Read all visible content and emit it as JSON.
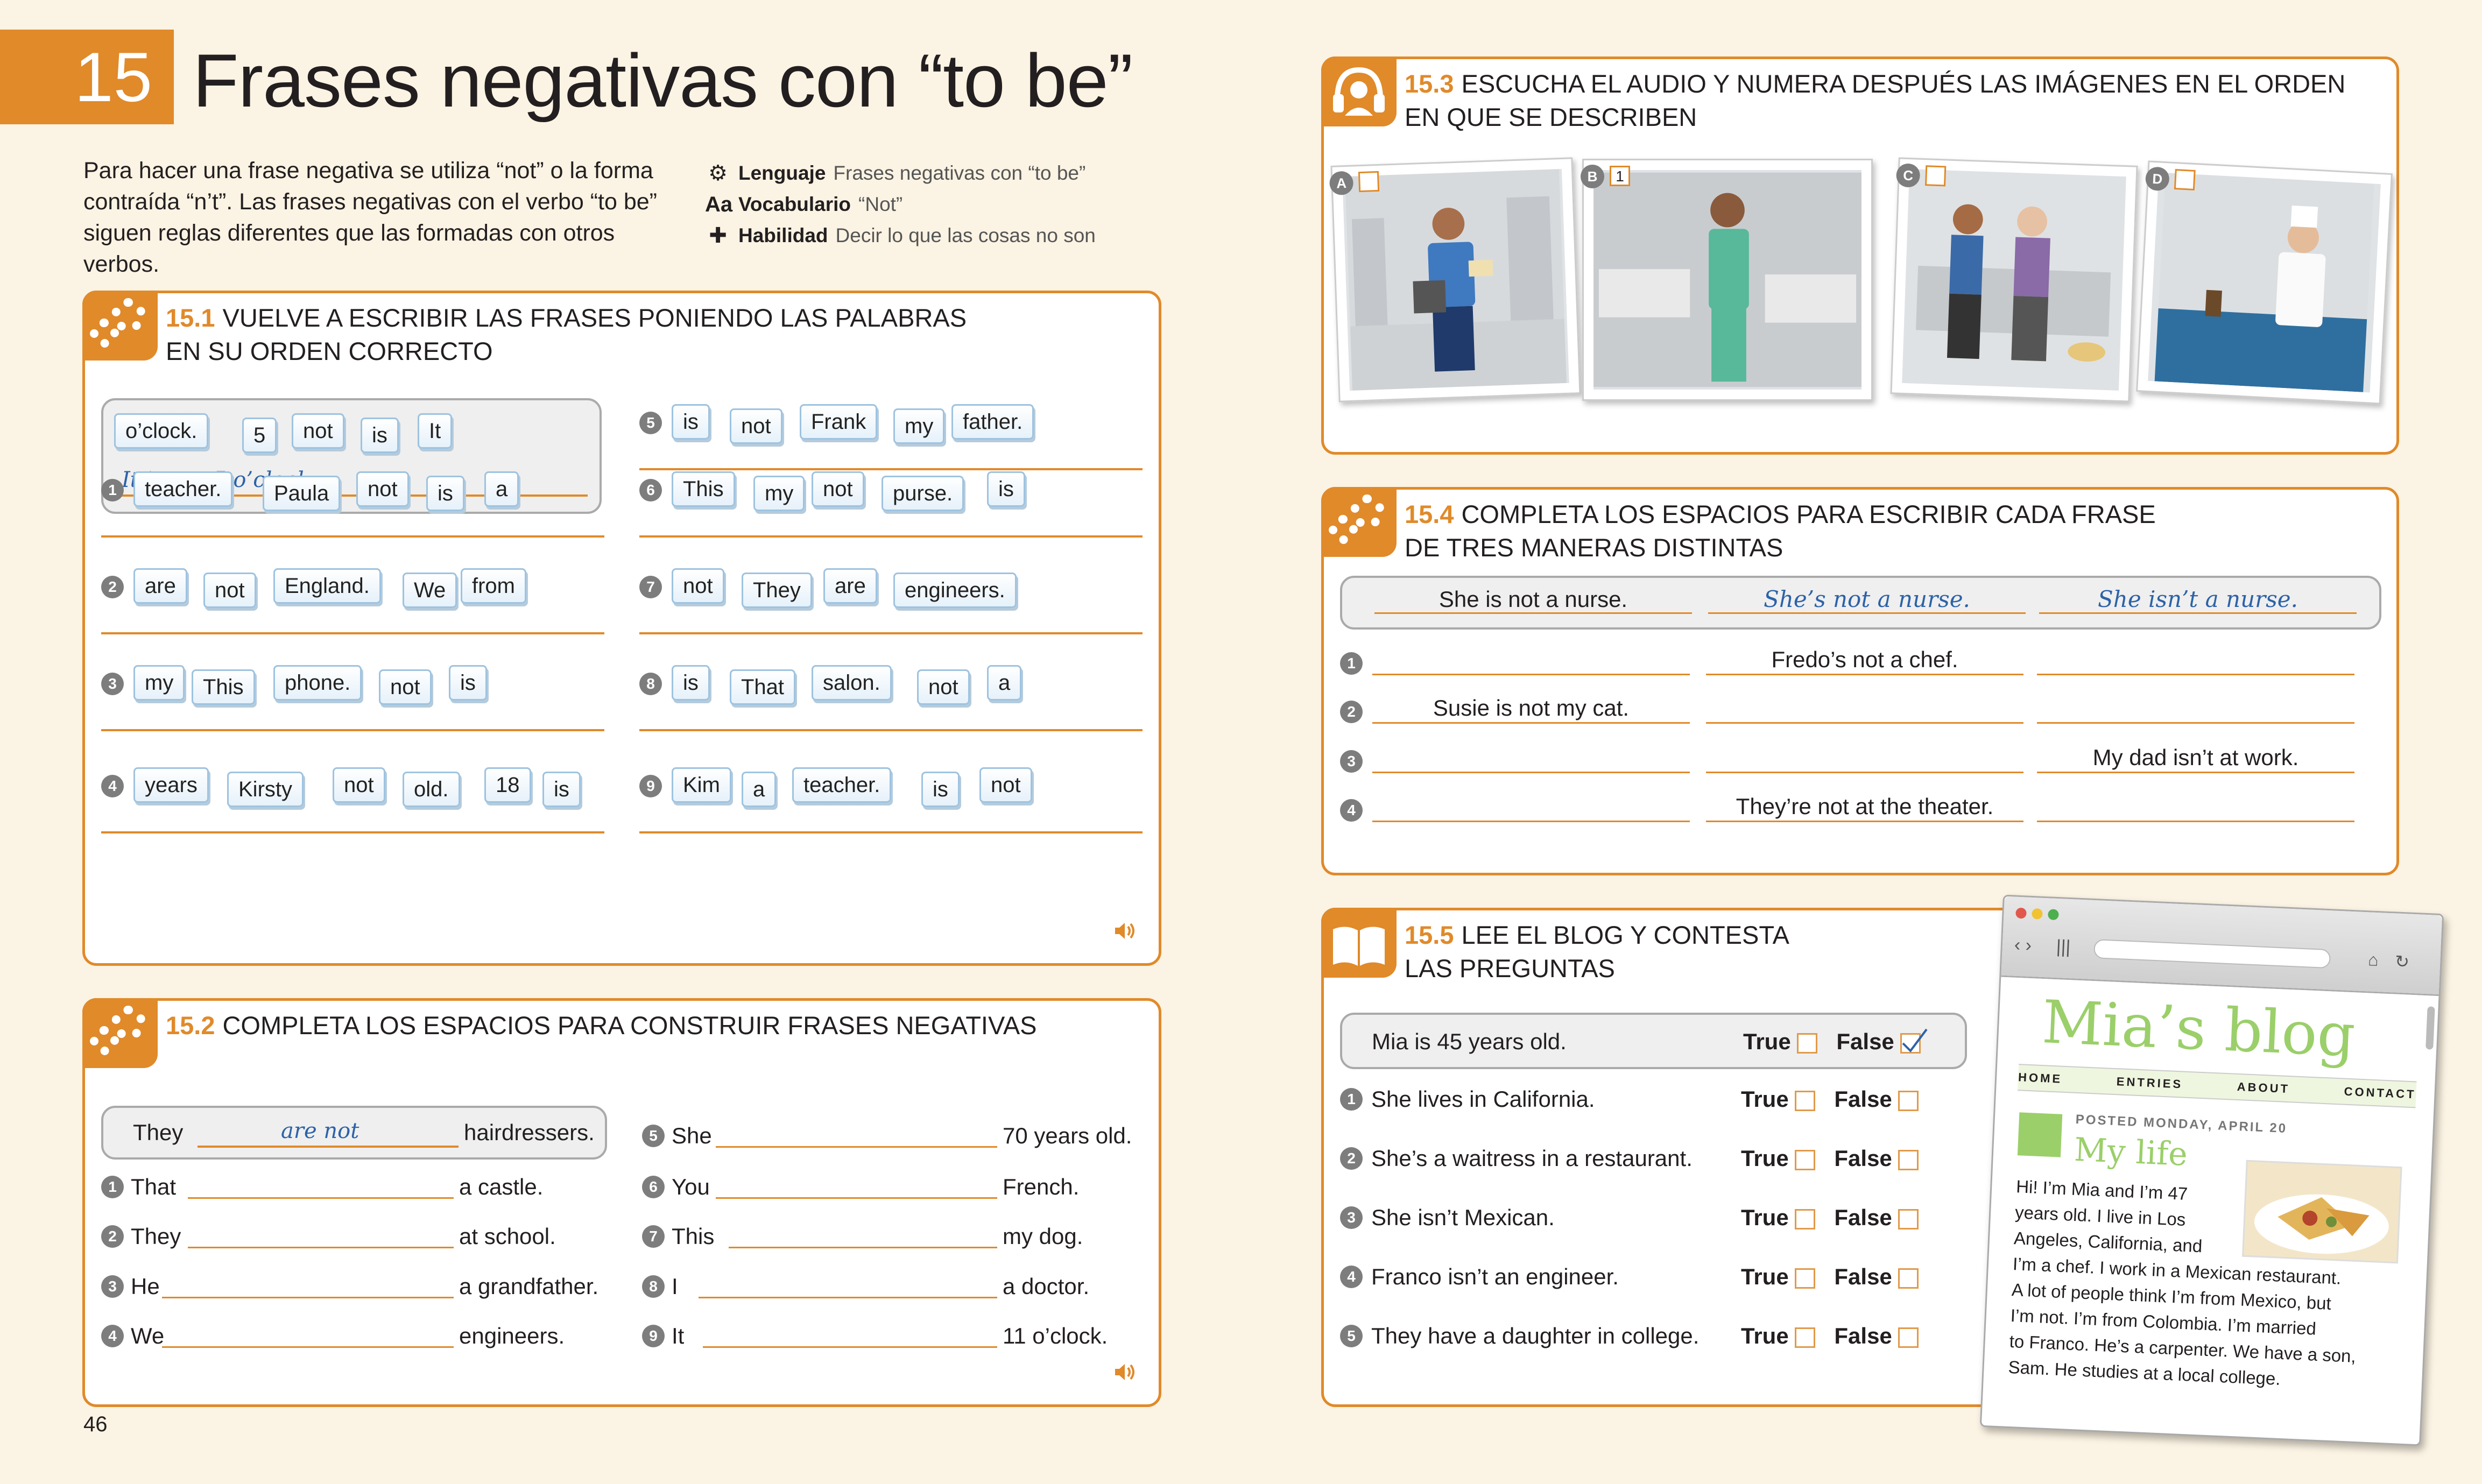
{
  "header": {
    "number": "15",
    "title": "Frases negativas con “to be”"
  },
  "intro": "Para hacer una frase negativa se utiliza “not” o la forma contraída “n’t”. Las frases negativas con el verbo “to be” siguen reglas diferentes que las formadas con otros verbos.",
  "meta": [
    {
      "icon": "gear-icon",
      "label": "Lenguaje",
      "value": "Frases negativas con “to be”"
    },
    {
      "icon": "aa-icon",
      "label": "Vocabulario",
      "value": "“Not”"
    },
    {
      "icon": "puzzle-icon",
      "label": "Habilidad",
      "value": "Decir lo que las cosas no son"
    }
  ],
  "page_number": "46",
  "s151": {
    "num": "15.1",
    "title": "VUELVE A ESCRIBIR LAS FRASES PONIENDO LAS PALABRAS",
    "title2": "EN SU ORDEN CORRECTO",
    "example": {
      "words": [
        "o’clock.",
        "5",
        "not",
        "is",
        "It"
      ],
      "answer": "It is not 5 o’clock."
    },
    "items": [
      {
        "n": "1",
        "words": [
          "teacher.",
          "Paula",
          "not",
          "is",
          "a"
        ]
      },
      {
        "n": "2",
        "words": [
          "are",
          "not",
          "England.",
          "We",
          "from"
        ]
      },
      {
        "n": "3",
        "words": [
          "my",
          "This",
          "phone.",
          "not",
          "is"
        ]
      },
      {
        "n": "4",
        "words": [
          "years",
          "Kirsty",
          "not",
          "old.",
          "18",
          "is"
        ]
      },
      {
        "n": "5",
        "words": [
          "is",
          "not",
          "Frank",
          "my",
          "father."
        ]
      },
      {
        "n": "6",
        "words": [
          "This",
          "my",
          "not",
          "purse.",
          "is"
        ]
      },
      {
        "n": "7",
        "words": [
          "not",
          "They",
          "are",
          "engineers."
        ]
      },
      {
        "n": "8",
        "words": [
          "is",
          "That",
          "salon.",
          "not",
          "a"
        ]
      },
      {
        "n": "9",
        "words": [
          "Kim",
          "a",
          "teacher.",
          "is",
          "not"
        ]
      }
    ]
  },
  "s152": {
    "num": "15.2",
    "title": "COMPLETA LOS ESPACIOS PARA CONSTRUIR FRASES NEGATIVAS",
    "example": {
      "subject": "They",
      "answer": "are not",
      "end": "hairdressers."
    },
    "items": [
      {
        "n": "1",
        "subject": "That",
        "end": "a castle."
      },
      {
        "n": "2",
        "subject": "They",
        "end": "at school."
      },
      {
        "n": "3",
        "subject": "He",
        "end": "a grandfather."
      },
      {
        "n": "4",
        "subject": "We",
        "end": "engineers."
      },
      {
        "n": "5",
        "subject": "She",
        "end": "70 years old."
      },
      {
        "n": "6",
        "subject": "You",
        "end": "French."
      },
      {
        "n": "7",
        "subject": "This",
        "end": "my dog."
      },
      {
        "n": "8",
        "subject": "I",
        "end": "a doctor."
      },
      {
        "n": "9",
        "subject": "It",
        "end": "11 o’clock."
      }
    ]
  },
  "s153": {
    "num": "15.3",
    "title": "ESCUCHA EL AUDIO Y NUMERA DESPUÉS LAS IMÁGENES EN EL ORDEN",
    "title2": "EN QUE SE DESCRIBEN",
    "pictures": [
      {
        "label": "A",
        "value": ""
      },
      {
        "label": "B",
        "value": "1"
      },
      {
        "label": "C",
        "value": ""
      },
      {
        "label": "D",
        "value": ""
      }
    ]
  },
  "s154": {
    "num": "15.4",
    "title": "COMPLETA LOS ESPACIOS PARA ESCRIBIR CADA FRASE",
    "title2": "DE TRES MANERAS DISTINTAS",
    "example": [
      "She is not a nurse.",
      "She’s not a nurse.",
      "She isn’t a nurse."
    ],
    "items": [
      {
        "n": "1",
        "cells": [
          "",
          "Fredo’s not a chef.",
          ""
        ]
      },
      {
        "n": "2",
        "cells": [
          "Susie is not my cat.",
          "",
          ""
        ]
      },
      {
        "n": "3",
        "cells": [
          "",
          "",
          "My dad isn’t at work."
        ]
      },
      {
        "n": "4",
        "cells": [
          "",
          "They’re not at the theater.",
          ""
        ]
      }
    ]
  },
  "s155": {
    "num": "15.5",
    "title": "LEE EL BLOG Y CONTESTA",
    "title2": "LAS PREGUNTAS",
    "true_label": "True",
    "false_label": "False",
    "example": {
      "text": "Mia is 45 years old.",
      "answer": "False"
    },
    "items": [
      {
        "n": "1",
        "text": "She lives in California."
      },
      {
        "n": "2",
        "text": "She’s a waitress in a restaurant."
      },
      {
        "n": "3",
        "text": "She isn’t Mexican."
      },
      {
        "n": "4",
        "text": "Franco isn’t an engineer."
      },
      {
        "n": "5",
        "text": "They have a daughter in college."
      }
    ]
  },
  "blog": {
    "title": "Mia’s blog",
    "nav": [
      "HOME",
      "ENTRIES",
      "ABOUT",
      "CONTACT"
    ],
    "posted": "POSTED MONDAY, APRIL 20",
    "post_title": "My life",
    "lines": [
      "Hi! I’m Mia and I’m 47",
      "years old. I live in Los",
      "Angeles, California, and",
      "I’m a chef. I work in a Mexican restaurant.",
      "A lot of people think I’m from Mexico, but",
      "I’m not. I’m from Colombia. I’m married",
      "to Franco. He’s a carpenter. We have a son,",
      "Sam. He studies at a local college."
    ]
  },
  "colors": {
    "accent": "#e08a2a",
    "page": "#fbf3e3",
    "handwriting": "#2c62a8"
  }
}
